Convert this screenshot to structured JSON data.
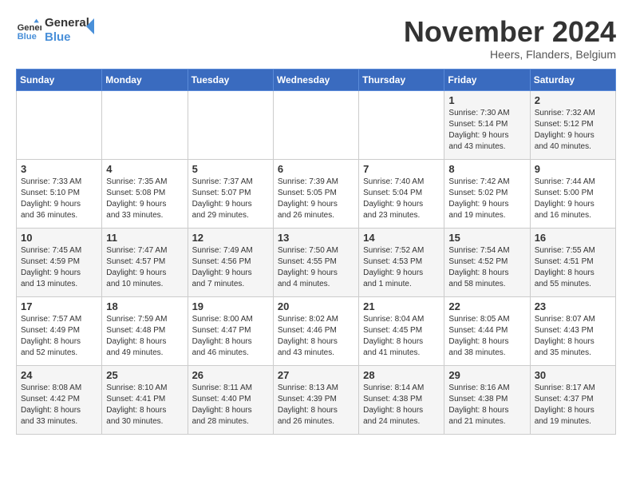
{
  "logo": {
    "line1": "General",
    "line2": "Blue"
  },
  "title": "November 2024",
  "location": "Heers, Flanders, Belgium",
  "days_of_week": [
    "Sunday",
    "Monday",
    "Tuesday",
    "Wednesday",
    "Thursday",
    "Friday",
    "Saturday"
  ],
  "weeks": [
    [
      {
        "day": "",
        "info": ""
      },
      {
        "day": "",
        "info": ""
      },
      {
        "day": "",
        "info": ""
      },
      {
        "day": "",
        "info": ""
      },
      {
        "day": "",
        "info": ""
      },
      {
        "day": "1",
        "info": "Sunrise: 7:30 AM\nSunset: 5:14 PM\nDaylight: 9 hours\nand 43 minutes."
      },
      {
        "day": "2",
        "info": "Sunrise: 7:32 AM\nSunset: 5:12 PM\nDaylight: 9 hours\nand 40 minutes."
      }
    ],
    [
      {
        "day": "3",
        "info": "Sunrise: 7:33 AM\nSunset: 5:10 PM\nDaylight: 9 hours\nand 36 minutes."
      },
      {
        "day": "4",
        "info": "Sunrise: 7:35 AM\nSunset: 5:08 PM\nDaylight: 9 hours\nand 33 minutes."
      },
      {
        "day": "5",
        "info": "Sunrise: 7:37 AM\nSunset: 5:07 PM\nDaylight: 9 hours\nand 29 minutes."
      },
      {
        "day": "6",
        "info": "Sunrise: 7:39 AM\nSunset: 5:05 PM\nDaylight: 9 hours\nand 26 minutes."
      },
      {
        "day": "7",
        "info": "Sunrise: 7:40 AM\nSunset: 5:04 PM\nDaylight: 9 hours\nand 23 minutes."
      },
      {
        "day": "8",
        "info": "Sunrise: 7:42 AM\nSunset: 5:02 PM\nDaylight: 9 hours\nand 19 minutes."
      },
      {
        "day": "9",
        "info": "Sunrise: 7:44 AM\nSunset: 5:00 PM\nDaylight: 9 hours\nand 16 minutes."
      }
    ],
    [
      {
        "day": "10",
        "info": "Sunrise: 7:45 AM\nSunset: 4:59 PM\nDaylight: 9 hours\nand 13 minutes."
      },
      {
        "day": "11",
        "info": "Sunrise: 7:47 AM\nSunset: 4:57 PM\nDaylight: 9 hours\nand 10 minutes."
      },
      {
        "day": "12",
        "info": "Sunrise: 7:49 AM\nSunset: 4:56 PM\nDaylight: 9 hours\nand 7 minutes."
      },
      {
        "day": "13",
        "info": "Sunrise: 7:50 AM\nSunset: 4:55 PM\nDaylight: 9 hours\nand 4 minutes."
      },
      {
        "day": "14",
        "info": "Sunrise: 7:52 AM\nSunset: 4:53 PM\nDaylight: 9 hours\nand 1 minute."
      },
      {
        "day": "15",
        "info": "Sunrise: 7:54 AM\nSunset: 4:52 PM\nDaylight: 8 hours\nand 58 minutes."
      },
      {
        "day": "16",
        "info": "Sunrise: 7:55 AM\nSunset: 4:51 PM\nDaylight: 8 hours\nand 55 minutes."
      }
    ],
    [
      {
        "day": "17",
        "info": "Sunrise: 7:57 AM\nSunset: 4:49 PM\nDaylight: 8 hours\nand 52 minutes."
      },
      {
        "day": "18",
        "info": "Sunrise: 7:59 AM\nSunset: 4:48 PM\nDaylight: 8 hours\nand 49 minutes."
      },
      {
        "day": "19",
        "info": "Sunrise: 8:00 AM\nSunset: 4:47 PM\nDaylight: 8 hours\nand 46 minutes."
      },
      {
        "day": "20",
        "info": "Sunrise: 8:02 AM\nSunset: 4:46 PM\nDaylight: 8 hours\nand 43 minutes."
      },
      {
        "day": "21",
        "info": "Sunrise: 8:04 AM\nSunset: 4:45 PM\nDaylight: 8 hours\nand 41 minutes."
      },
      {
        "day": "22",
        "info": "Sunrise: 8:05 AM\nSunset: 4:44 PM\nDaylight: 8 hours\nand 38 minutes."
      },
      {
        "day": "23",
        "info": "Sunrise: 8:07 AM\nSunset: 4:43 PM\nDaylight: 8 hours\nand 35 minutes."
      }
    ],
    [
      {
        "day": "24",
        "info": "Sunrise: 8:08 AM\nSunset: 4:42 PM\nDaylight: 8 hours\nand 33 minutes."
      },
      {
        "day": "25",
        "info": "Sunrise: 8:10 AM\nSunset: 4:41 PM\nDaylight: 8 hours\nand 30 minutes."
      },
      {
        "day": "26",
        "info": "Sunrise: 8:11 AM\nSunset: 4:40 PM\nDaylight: 8 hours\nand 28 minutes."
      },
      {
        "day": "27",
        "info": "Sunrise: 8:13 AM\nSunset: 4:39 PM\nDaylight: 8 hours\nand 26 minutes."
      },
      {
        "day": "28",
        "info": "Sunrise: 8:14 AM\nSunset: 4:38 PM\nDaylight: 8 hours\nand 24 minutes."
      },
      {
        "day": "29",
        "info": "Sunrise: 8:16 AM\nSunset: 4:38 PM\nDaylight: 8 hours\nand 21 minutes."
      },
      {
        "day": "30",
        "info": "Sunrise: 8:17 AM\nSunset: 4:37 PM\nDaylight: 8 hours\nand 19 minutes."
      }
    ]
  ]
}
